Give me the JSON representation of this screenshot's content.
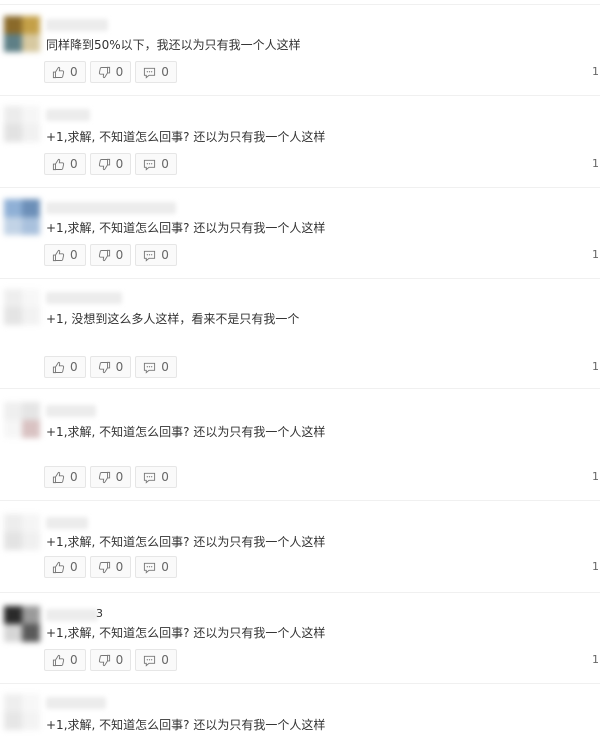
{
  "comments": [
    {
      "text": "同样降到50%以下，我还以为只有我一个人这样",
      "name_suffix": "",
      "likes": "0",
      "dislikes": "0",
      "replies": "0",
      "edge": "1",
      "avatar_colors": [
        "#8a6a2a",
        "#c4a048",
        "#5e7f86",
        "#d7c9a0"
      ]
    },
    {
      "text": "+1,求解, 不知道怎么回事? 还以为只有我一个人这样",
      "name_suffix": "",
      "likes": "0",
      "dislikes": "0",
      "replies": "0",
      "edge": "1",
      "avatar_colors": [
        "#ececec",
        "#f6f6f6",
        "#e2e2e2",
        "#f1f1f1"
      ]
    },
    {
      "text": "+1,求解, 不知道怎么回事? 还以为只有我一个人这样",
      "name_suffix": "",
      "likes": "0",
      "dislikes": "0",
      "replies": "0",
      "edge": "1",
      "avatar_colors": [
        "#8fb0d6",
        "#6c8fb8",
        "#c2d3e6",
        "#a9c1dd"
      ]
    },
    {
      "text": "+1, 没想到这么多人这样，看来不是只有我一个",
      "name_suffix": "",
      "likes": "0",
      "dislikes": "0",
      "replies": "0",
      "edge": "1",
      "avatar_colors": [
        "#eeeeee",
        "#f7f7f7",
        "#e4e4e4",
        "#f2f2f2"
      ]
    },
    {
      "text": "+1,求解, 不知道怎么回事? 还以为只有我一个人这样",
      "name_suffix": "",
      "likes": "0",
      "dislikes": "0",
      "replies": "0",
      "edge": "1",
      "avatar_colors": [
        "#efefef",
        "#e5e5e5",
        "#f6f6f6",
        "#d9c2c2"
      ]
    },
    {
      "text": "+1,求解, 不知道怎么回事? 还以为只有我一个人这样",
      "name_suffix": "",
      "likes": "0",
      "dislikes": "0",
      "replies": "0",
      "edge": "1",
      "avatar_colors": [
        "#ededed",
        "#f5f5f5",
        "#e3e3e3",
        "#f0f0f0"
      ]
    },
    {
      "text": "+1,求解, 不知道怎么回事? 还以为只有我一个人这样",
      "name_suffix": "3",
      "likes": "0",
      "dislikes": "0",
      "replies": "0",
      "edge": "1",
      "avatar_colors": [
        "#2a2a2a",
        "#9a9a9a",
        "#d6d6d6",
        "#5a5a5a"
      ]
    },
    {
      "text": "+1,求解, 不知道怎么回事? 还以为只有我一个人这样",
      "name_suffix": "",
      "likes": null,
      "dislikes": null,
      "replies": null,
      "edge": null,
      "avatar_colors": [
        "#eeeeee",
        "#f7f7f7",
        "#e6e6e6",
        "#f3f3f3"
      ]
    }
  ]
}
